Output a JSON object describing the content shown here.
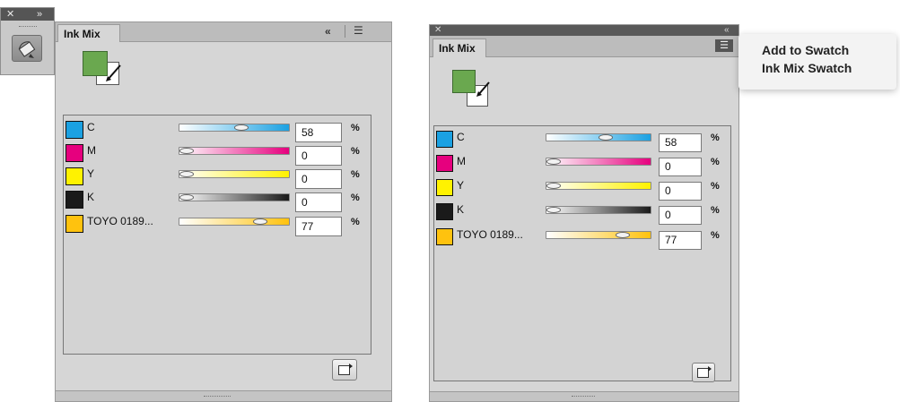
{
  "dock": {
    "close_glyph": "✕",
    "expand_glyph": "»",
    "tool_icon": "bucket-icon"
  },
  "left_panel": {
    "tab_label": "Ink Mix",
    "collapse_glyph": "«",
    "menu_glyph": "☰",
    "inks": [
      {
        "name": "C",
        "value": "58",
        "pct": "%",
        "color": "#1ba1e2",
        "slider_value": 0.58
      },
      {
        "name": "M",
        "value": "0",
        "pct": "%",
        "color": "#e6007e",
        "slider_value": 0.0
      },
      {
        "name": "Y",
        "value": "0",
        "pct": "%",
        "color": "#fff200",
        "slider_value": 0.0
      },
      {
        "name": "K",
        "value": "0",
        "pct": "%",
        "color": "#1a1a1a",
        "slider_value": 0.0
      },
      {
        "name": "TOYO 0189...",
        "value": "77",
        "pct": "%",
        "color": "#ffc20e",
        "slider_value": 0.77
      }
    ]
  },
  "right_panel": {
    "tab_label": "Ink Mix",
    "close_glyph": "✕",
    "collapse_glyph": "«",
    "menu_glyph": "☰",
    "inks": [
      {
        "name": "C",
        "value": "58",
        "pct": "%",
        "color": "#1ba1e2",
        "slider_value": 0.58
      },
      {
        "name": "M",
        "value": "0",
        "pct": "%",
        "color": "#e6007e",
        "slider_value": 0.0
      },
      {
        "name": "Y",
        "value": "0",
        "pct": "%",
        "color": "#fff200",
        "slider_value": 0.0
      },
      {
        "name": "K",
        "value": "0",
        "pct": "%",
        "color": "#1a1a1a",
        "slider_value": 0.0
      },
      {
        "name": "TOYO 0189...",
        "value": "77",
        "pct": "%",
        "color": "#ffc20e",
        "slider_value": 0.77
      }
    ]
  },
  "flyout_menu": {
    "items": [
      "Add to Swatch",
      "Ink Mix Swatch"
    ]
  },
  "colors": {
    "mix_green": "#6aa84f"
  }
}
